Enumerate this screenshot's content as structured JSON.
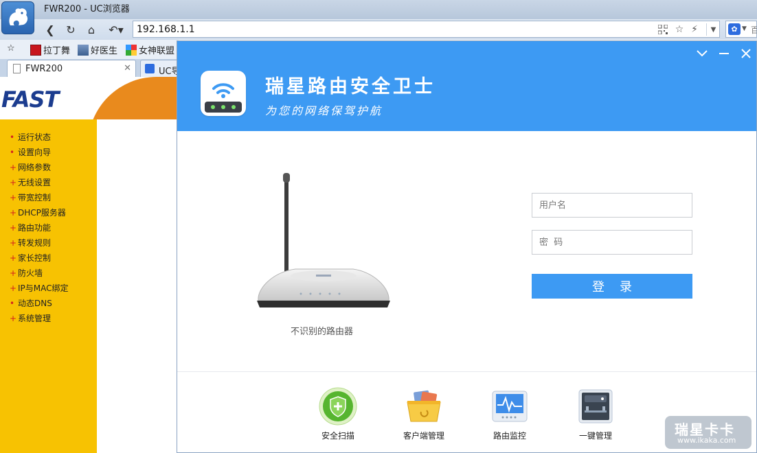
{
  "browser": {
    "window_title": "FWR200 - UC浏览器",
    "address": "192.168.1.1",
    "search_engine_label": "百",
    "bookmarks": [
      {
        "label": "拉丁舞"
      },
      {
        "label": "好医生"
      },
      {
        "label": "女神联盟"
      }
    ],
    "tabs": [
      {
        "label": "FWR200"
      },
      {
        "label": "UC导"
      }
    ]
  },
  "fast_page": {
    "logo": "FAST",
    "menu": [
      {
        "label": "运行状态"
      },
      {
        "label": "设置向导"
      },
      {
        "label": "网络参数"
      },
      {
        "label": "无线设置"
      },
      {
        "label": "带宽控制"
      },
      {
        "label": "DHCP服务器"
      },
      {
        "label": "路由功能"
      },
      {
        "label": "转发规则"
      },
      {
        "label": "家长控制"
      },
      {
        "label": "防火墙"
      },
      {
        "label": "IP与MAC绑定"
      },
      {
        "label": "动态DNS"
      },
      {
        "label": "系统管理"
      }
    ],
    "colors": {
      "sidebar": "#f7c202",
      "accent": "#e98a1d",
      "logo": "#1b3c8f"
    }
  },
  "popup": {
    "title": "瑞星路由安全卫士",
    "subtitle": "为您的网络保驾护航",
    "router_caption": "不识别的路由器",
    "username_placeholder": "用户名",
    "password_placeholder": "密  码",
    "login_label": "登录",
    "tools": [
      {
        "label": "安全扫描",
        "icon": "shield-plus-icon"
      },
      {
        "label": "客户端管理",
        "icon": "basket-icon"
      },
      {
        "label": "路由监控",
        "icon": "monitor-icon"
      },
      {
        "label": "一键管理",
        "icon": "router-panel-icon"
      }
    ],
    "colors": {
      "brand": "#3d9af3"
    }
  },
  "watermark": {
    "main": "瑞星卡卡",
    "url": "www.ikaka.com"
  }
}
